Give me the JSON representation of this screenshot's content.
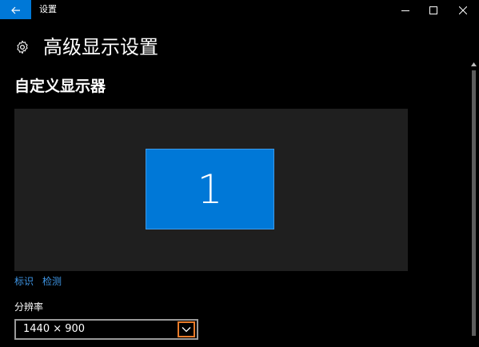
{
  "window": {
    "title": "设置",
    "back_icon": "back-arrow-icon",
    "controls": [
      "minimize-icon",
      "maximize-icon",
      "close-icon"
    ]
  },
  "header": {
    "icon": "gear-icon",
    "title": "高级显示设置"
  },
  "section": {
    "title": "自定义显示器"
  },
  "display_arrangement": {
    "monitors": [
      {
        "number": "1",
        "selected": true
      }
    ]
  },
  "links": {
    "identify": "标识",
    "detect": "检测"
  },
  "resolution": {
    "label": "分辨率",
    "value": "1440 × 900",
    "dropdown_icon": "chevron-down-icon"
  },
  "colors": {
    "accent": "#0078d7",
    "link": "#3f96e6",
    "highlight_box": "#e87b2a",
    "background": "#000000",
    "panel": "#1f1f1f"
  }
}
